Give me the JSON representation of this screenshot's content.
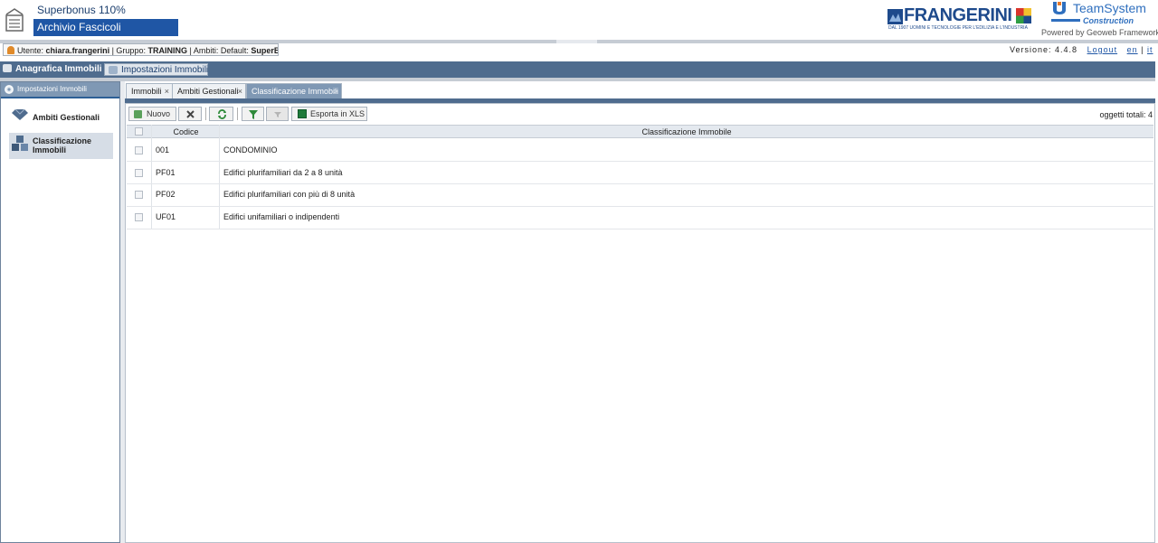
{
  "app": {
    "title": "Superbonus 110%",
    "subtitle": "Archivio Fascicoli"
  },
  "brand": {
    "frangerini": "FRANGERINI",
    "frangerini_tagline": "DAL 1907 UOMINI E TECNOLOGIE PER L'EDILIZIA E L'INDUSTRIA",
    "teamsystem": "TeamSystem",
    "teamsystem_sub": "Construction",
    "powered_by": "Powered by Geoweb Framework",
    "accent": "#1f56a5"
  },
  "user_bar": {
    "utente_label": "Utente:",
    "utente_value": "chiara.frangerini",
    "gruppo_label": "| Gruppo:",
    "gruppo_value": "TRAINING",
    "ambiti_label": "| Ambiti: Default:",
    "ambiti_value": "SuperBonus",
    "version_label": "Versione: 4.4.8",
    "logout": "Logout",
    "lang_en": "en",
    "lang_sep": "|",
    "lang_it": "it"
  },
  "nav": {
    "anagrafica": "Anagrafica Immobili",
    "impostazioni": "Impostazioni Immobili"
  },
  "left_panel": {
    "header": "Impostazioni Immobili",
    "items": [
      {
        "label": "Ambiti Gestionali",
        "icon": "diamond-icon"
      },
      {
        "label": "Classificazione Immobili",
        "icon": "cubes-icon",
        "selected": true
      }
    ]
  },
  "tabs": [
    {
      "label": "Immobili",
      "close": "×"
    },
    {
      "label": "Ambiti Gestionali",
      "close": "×"
    },
    {
      "label": "Classificazione Immobili",
      "close": "×",
      "active": true
    }
  ],
  "toolbar": {
    "new_label": "Nuovo",
    "export_label": "Esporta in XLS",
    "count_label": "oggetti totali: 4"
  },
  "table": {
    "columns": [
      "Codice",
      "Classificazione Immobile"
    ],
    "rows": [
      {
        "codice": "001",
        "descr": "CONDOMINIO"
      },
      {
        "codice": "PF01",
        "descr": "Edifici plurifamiliari da 2 a 8 unità"
      },
      {
        "codice": "PF02",
        "descr": "Edifici plurifamiliari con più di 8 unità"
      },
      {
        "codice": "UF01",
        "descr": "Edifici unifamiliari o indipendenti"
      }
    ]
  }
}
